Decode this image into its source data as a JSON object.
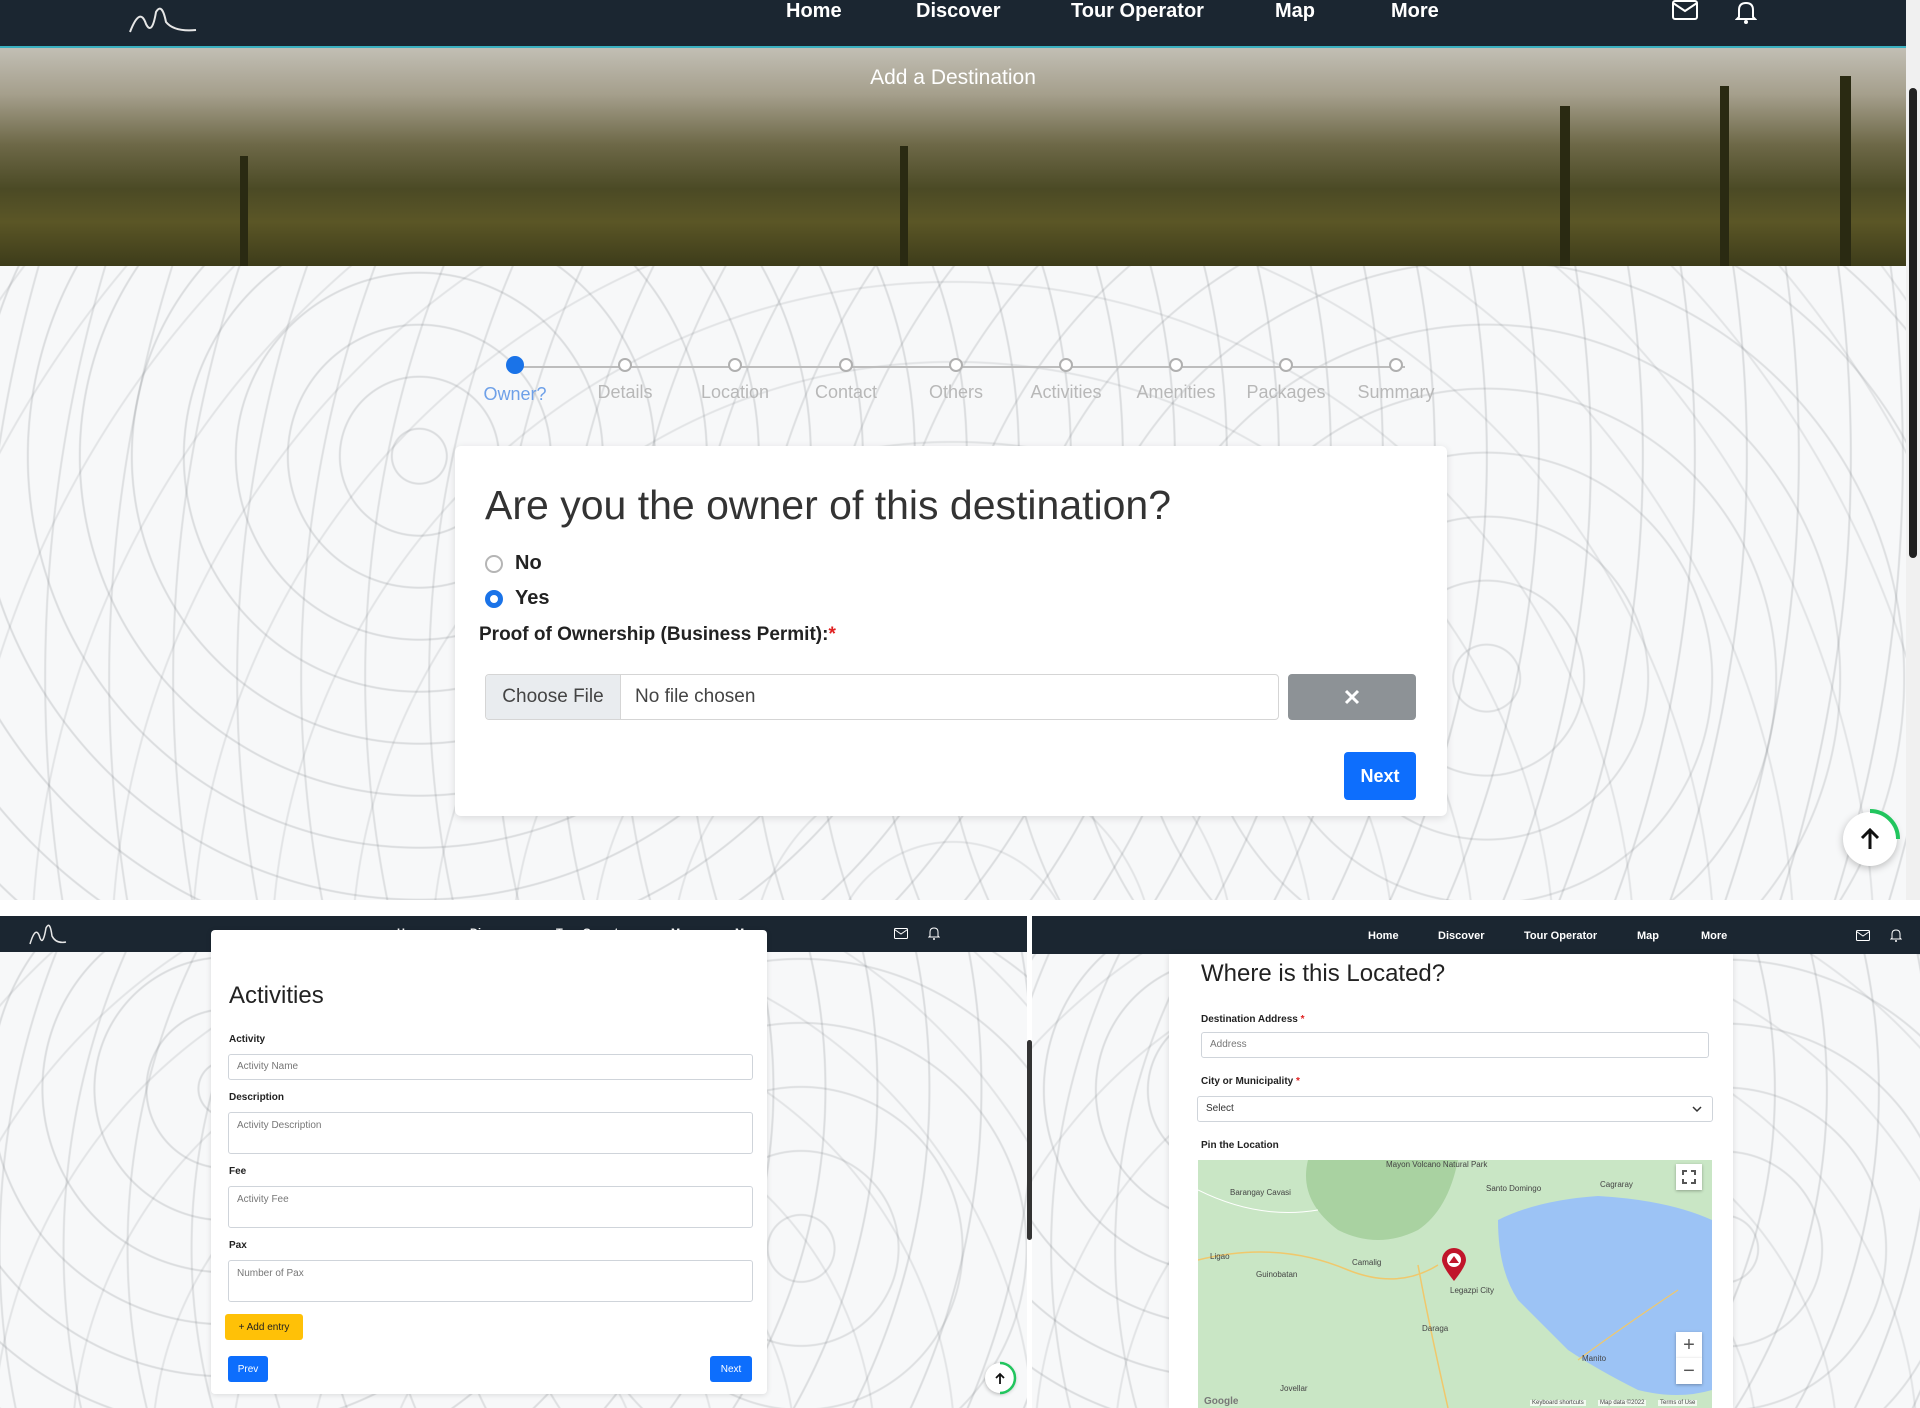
{
  "nav": {
    "links": [
      "Home",
      "Discover",
      "Tour Operator",
      "Map",
      "More"
    ]
  },
  "main": {
    "hero_title": "Add a Destination",
    "steps": [
      "Owner?",
      "Details",
      "Location",
      "Contact",
      "Others",
      "Activities",
      "Amenities",
      "Packages",
      "Summary"
    ],
    "question": "Are you the owner of this destination?",
    "options": [
      "No",
      "Yes"
    ],
    "selected_option": "Yes",
    "proof_label": "Proof of Ownership (Business Permit):",
    "required_mark": "*",
    "choose_file": "Choose File",
    "file_name": "No file chosen",
    "next_label": "Next"
  },
  "activities": {
    "title": "Activities",
    "activity_label": "Activity",
    "activity_placeholder": "Activity Name",
    "description_label": "Description",
    "description_placeholder": "Activity Description",
    "fee_label": "Fee",
    "fee_placeholder": "Activity Fee",
    "pax_label": "Pax",
    "pax_placeholder": "Number of Pax",
    "add_entry": "+ Add entry",
    "prev_label": "Prev",
    "next_label": "Next"
  },
  "location": {
    "title": "Where is this Located?",
    "address_label": "Destination Address",
    "address_placeholder": "Address",
    "city_label": "City or Municipality",
    "city_selected": "Select",
    "pin_label": "Pin the Location",
    "map_labels": [
      "Mayon Volcano Natural Park",
      "Barangay Cavasi",
      "Santo Domingo",
      "Cagraray",
      "Camalig",
      "Ligao",
      "Guinobatan",
      "Legazpi City",
      "Daraga",
      "Manito",
      "Jovellar"
    ],
    "map_footer": [
      "Keyboard shortcuts",
      "Map data ©2022",
      "Terms of Use"
    ],
    "map_brand": "Google",
    "zoom_in": "+",
    "zoom_out": "−"
  },
  "colors": {
    "nav_bg": "#1b2631",
    "primary": "#0d6efd",
    "warning": "#ffc107",
    "required": "#e02020"
  },
  "icons": [
    "logo-icon",
    "mail-icon",
    "bell-icon",
    "close-icon",
    "arrow-up-icon",
    "chevron-down-icon",
    "map-pin-icon",
    "fullscreen-icon"
  ]
}
